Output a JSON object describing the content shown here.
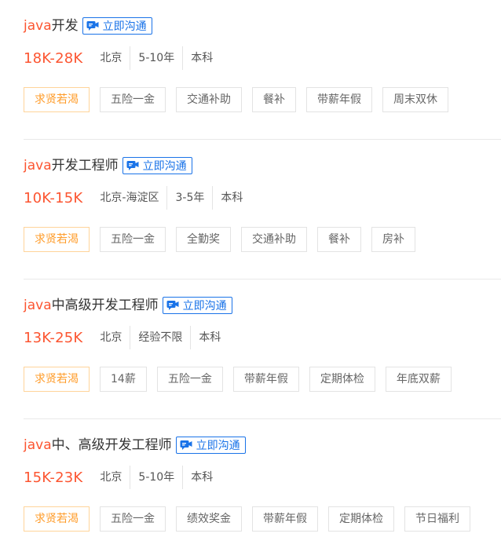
{
  "colors": {
    "keyword": "#fc5531",
    "salary": "#fc5531",
    "chat_blue": "#1a73e8",
    "urgent_orange": "#ff9c2a"
  },
  "chat_icon": "video-chat-icon",
  "jobs": [
    {
      "title_keyword": "java",
      "title_rest": "开发",
      "chat_label": "立即沟通",
      "salary": "18K-28K",
      "meta": [
        "北京",
        "5-10年",
        "本科"
      ],
      "tags": [
        "求贤若渴",
        "五险一金",
        "交通补助",
        "餐补",
        "带薪年假",
        "周末双休"
      ]
    },
    {
      "title_keyword": "java",
      "title_rest": "开发工程师",
      "chat_label": "立即沟通",
      "salary": "10K-15K",
      "meta": [
        "北京-海淀区",
        "3-5年",
        "本科"
      ],
      "tags": [
        "求贤若渴",
        "五险一金",
        "全勤奖",
        "交通补助",
        "餐补",
        "房补"
      ]
    },
    {
      "title_keyword": "java",
      "title_rest": "中高级开发工程师",
      "chat_label": "立即沟通",
      "salary": "13K-25K",
      "meta": [
        "北京",
        "经验不限",
        "本科"
      ],
      "tags": [
        "求贤若渴",
        "14薪",
        "五险一金",
        "带薪年假",
        "定期体检",
        "年底双薪"
      ]
    },
    {
      "title_keyword": "java",
      "title_rest": "中、高级开发工程师",
      "chat_label": "立即沟通",
      "salary": "15K-23K",
      "meta": [
        "北京",
        "5-10年",
        "本科"
      ],
      "tags": [
        "求贤若渴",
        "五险一金",
        "绩效奖金",
        "带薪年假",
        "定期体检",
        "节日福利"
      ]
    }
  ]
}
